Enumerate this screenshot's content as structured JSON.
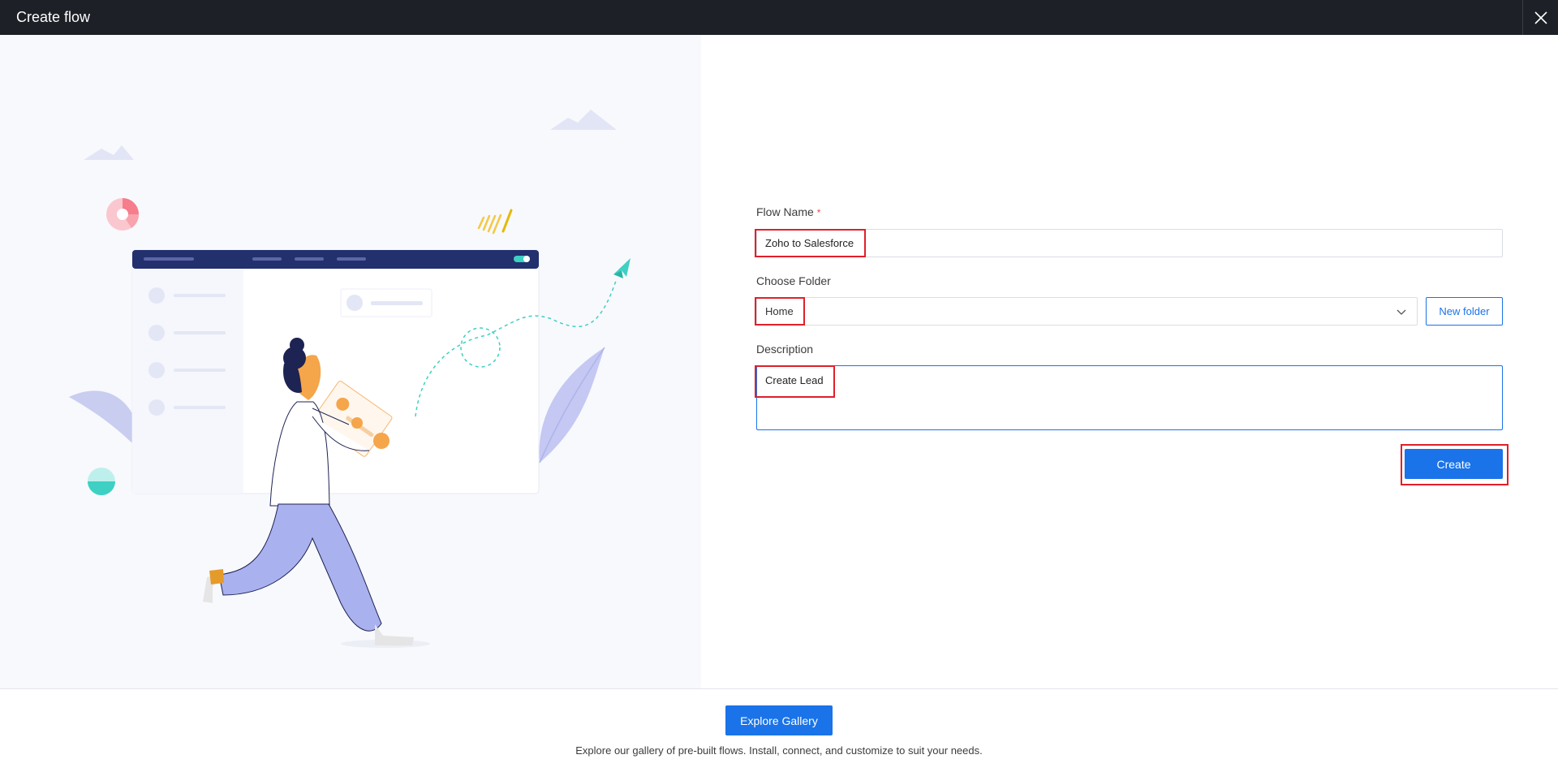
{
  "window": {
    "title": "Create flow",
    "close_icon": "close-icon"
  },
  "form": {
    "flow_name_label": "Flow Name",
    "required_mark": "*",
    "flow_name_value": "Zoho to Salesforce",
    "folder_label": "Choose Folder",
    "folder_value": "Home",
    "new_folder_label": "New folder",
    "description_label": "Description",
    "description_value": "Create Lead",
    "create_label": "Create"
  },
  "footer": {
    "explore_label": "Explore Gallery",
    "explore_text": "Explore our gallery of pre-built flows. Install, connect, and customize to suit your needs."
  },
  "colors": {
    "accent": "#1a73e8",
    "titlebar": "#1d2026",
    "highlight": "#e0202a",
    "illustration_bg": "#f8f9fd"
  }
}
